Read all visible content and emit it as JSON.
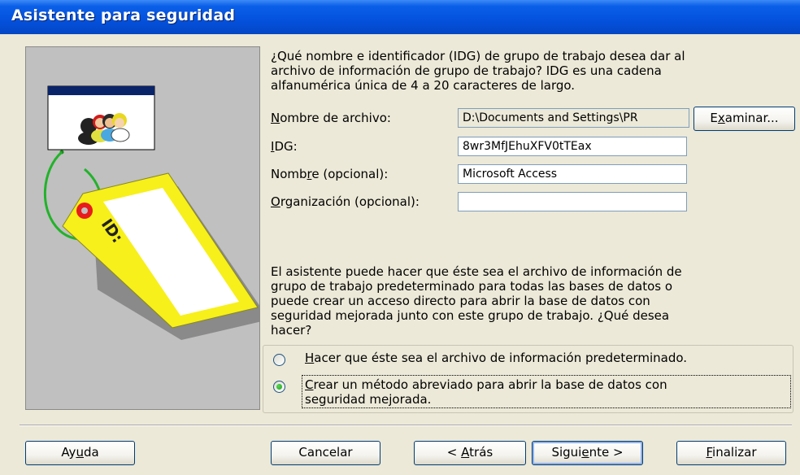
{
  "window": {
    "title": "Asistente para seguridad"
  },
  "intro": {
    "lines": [
      "¿Qué nombre e identificador (IDG) de grupo de trabajo desea dar al",
      "archivo de información de grupo de trabajo? IDG es una cadena",
      "alfanumérica única de 4 a 20 caracteres de largo."
    ]
  },
  "fields": {
    "filename": {
      "label_pre": "",
      "label_key": "N",
      "label_post": "ombre de archivo:",
      "value": "D:\\Documents and Settings\\PR"
    },
    "idg": {
      "label_pre": "",
      "label_key": "I",
      "label_post": "DG:",
      "value": "8wr3MfJEhuXFV0tTEax"
    },
    "name": {
      "label_pre": "Nomb",
      "label_key": "r",
      "label_post": "e (opcional):",
      "value": "Microsoft Access"
    },
    "org": {
      "label_pre": "",
      "label_key": "O",
      "label_post": "rganización (opcional):",
      "value": ""
    }
  },
  "browse_button": {
    "pre": "E",
    "key": "x",
    "post": "aminar..."
  },
  "description": {
    "lines": [
      "El asistente puede hacer que éste sea el archivo de información de",
      "grupo de trabajo predeterminado para todas las bases de datos o",
      "puede crear un acceso directo para abrir la base de datos con",
      "seguridad mejorada junto con este grupo de trabajo. ¿Qué desea",
      "hacer?"
    ]
  },
  "options": [
    {
      "key": "H",
      "rest": "acer que éste sea el archivo de información predeterminado.",
      "line2": "",
      "selected": false
    },
    {
      "key": "C",
      "rest": "rear un método abreviado para abrir la base de datos con",
      "line2": "seguridad mejorada.",
      "selected": true
    }
  ],
  "buttons": {
    "help": {
      "pre": "Ay",
      "key": "u",
      "post": "da"
    },
    "cancel": {
      "pre": "",
      "key": "",
      "post": "Cancelar"
    },
    "back": {
      "pre": "< ",
      "key": "A",
      "post": "trás"
    },
    "next": {
      "pre": "Sigui",
      "key": "e",
      "post": "nte >"
    },
    "finish": {
      "pre": "",
      "key": "F",
      "post": "inalizar"
    }
  },
  "colors": {
    "titlebar": "#0451dd",
    "dialog_bg": "#ece9d8",
    "panel_bg": "#c0c0c0",
    "tag_yellow": "#f7f01a",
    "ring_green": "#22b22a",
    "eyelet_red": "#e81c1c"
  },
  "icons": [
    "users-icon",
    "id-tag-icon"
  ]
}
